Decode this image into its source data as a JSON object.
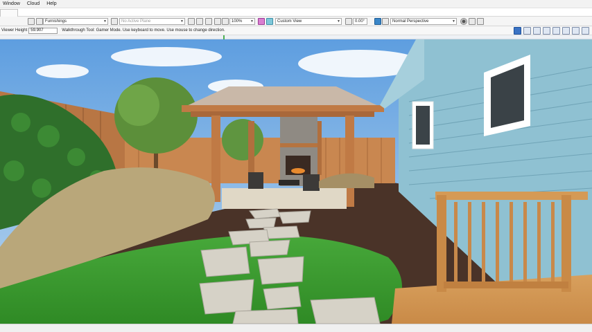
{
  "menu": {
    "items": [
      "Window",
      "Cloud",
      "Help"
    ]
  },
  "toolbar": {
    "layer_combo": "Furnishings",
    "plane_combo": "No Active Plane",
    "zoom_combo": "100%",
    "view_combo": "Custom View",
    "angle_field": "0.00°",
    "perspective_combo": "Normal Perspective"
  },
  "status": {
    "viewer_height_label": "Viewer Height",
    "viewer_height_value": "59.907",
    "message": "Walkthrough Tool: Gamer Mode. Use keyboard to move. Use mouse to change direction."
  },
  "icons": {
    "layer": "layer-icon",
    "view": "camera-icon",
    "render": "render-icon",
    "select": "select-arrow-icon"
  },
  "colors": {
    "sky": "#7fb3e6",
    "lawn": "#3f9e2f",
    "mulch": "#4a3328",
    "siding": "#8fc1d2",
    "cedar": "#c07a45",
    "stone": "#d6d2c7"
  }
}
